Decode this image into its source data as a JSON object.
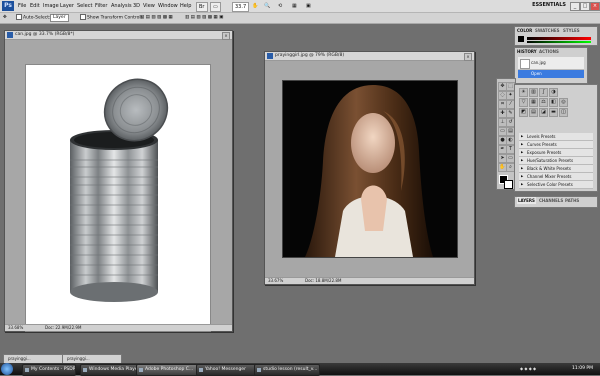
{
  "menubar": {
    "items": [
      "File",
      "Edit",
      "Image",
      "Layer",
      "Select",
      "Filter",
      "Analysis",
      "3D",
      "View",
      "Window",
      "Help"
    ],
    "zoom": "33.7",
    "workspace": "ESSENTIALS",
    "win_min": "_",
    "win_max": "□",
    "win_close": "×"
  },
  "options": {
    "auto_select": "Auto-Select:",
    "layer_dropdown": "Layer",
    "transform_controls": "Show Transform Controls"
  },
  "doc_can": {
    "title": "can.jpg @ 33.7% (RGB/8*)",
    "zoom": "33.68%",
    "doc_size": "Doc: 22.9M/22.9M"
  },
  "doc_girl": {
    "title": "prayinggirl.jpg @ 79% (RGB/8)",
    "zoom": "33.67%",
    "doc_size": "Doc: 18.8M/22.8M"
  },
  "history": {
    "tabs": [
      "HISTORY",
      "ACTIONS"
    ],
    "snapshot": "can.jpg",
    "state": "Open"
  },
  "color": {
    "tabs": [
      "COLOR",
      "SWATCHES",
      "STYLES"
    ]
  },
  "adjustments": {
    "items": [
      "Levels Presets",
      "Curves Presets",
      "Exposure Presets",
      "Hue/Saturation Presets",
      "Black & White Presets",
      "Channel Mixer Presets",
      "Selective Color Presets"
    ]
  },
  "layers": {
    "tabs": [
      "LAYERS",
      "CHANNELS",
      "PATHS"
    ]
  },
  "minimized": [
    "prayinggi...",
    "prayinggi..."
  ],
  "taskbar": {
    "items": [
      "My Contents - PSDR",
      "Windows Media Player",
      "Adobe Photoshop C...",
      "Yahoo! Messenger",
      "studio lesson (result_v..."
    ],
    "clock": "11:09 PM"
  }
}
